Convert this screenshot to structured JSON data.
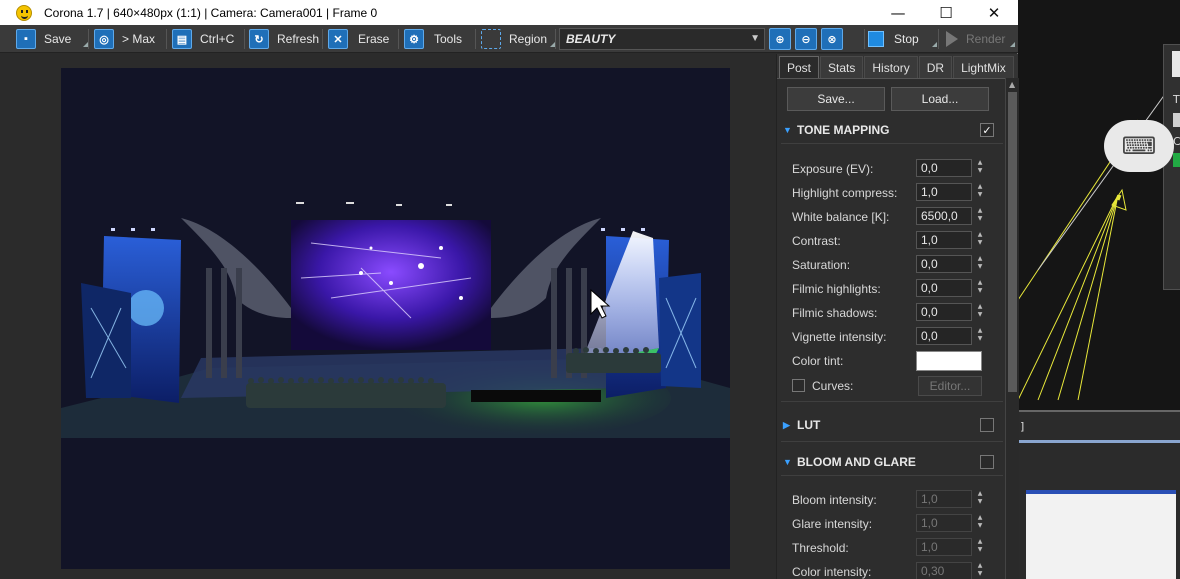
{
  "window": {
    "title": "Corona 1.7 | 640×480px (1:1) | Camera: Camera001 | Frame 0",
    "minimize": "—",
    "maximize": "☐",
    "close": "✕"
  },
  "toolbar": {
    "save": "Save",
    "max": "> Max",
    "copy": "Ctrl+C",
    "refresh": "Refresh",
    "erase": "Erase",
    "tools": "Tools",
    "region": "Region",
    "channel": "BEAUTY",
    "stop": "Stop",
    "render": "Render"
  },
  "tabs": [
    "Post",
    "Stats",
    "History",
    "DR",
    "LightMix"
  ],
  "post": {
    "save_btn": "Save...",
    "load_btn": "Load...",
    "tone_mapping": {
      "title": "TONE MAPPING",
      "enabled": "✓",
      "props": [
        {
          "label": "Exposure (EV):",
          "value": "0,0"
        },
        {
          "label": "Highlight compress:",
          "value": "1,0"
        },
        {
          "label": "White balance [K]:",
          "value": "6500,0"
        },
        {
          "label": "Contrast:",
          "value": "1,0"
        },
        {
          "label": "Saturation:",
          "value": "0,0"
        },
        {
          "label": "Filmic highlights:",
          "value": "0,0"
        },
        {
          "label": "Filmic shadows:",
          "value": "0,0"
        },
        {
          "label": "Vignette intensity:",
          "value": "0,0"
        }
      ],
      "color_tint_label": "Color tint:",
      "color_tint": "#ffffff",
      "curves_label": "Curves:",
      "editor_btn": "Editor..."
    },
    "lut": {
      "title": "LUT"
    },
    "bloom": {
      "title": "BLOOM AND GLARE",
      "props": [
        {
          "label": "Bloom intensity:",
          "value": "1,0"
        },
        {
          "label": "Glare intensity:",
          "value": "1,0"
        },
        {
          "label": "Threshold:",
          "value": "1,0"
        },
        {
          "label": "Color intensity:",
          "value": "0,30"
        }
      ]
    }
  },
  "colors": {
    "accent": "#1f6fb8",
    "panel_bg": "#2d2d2d",
    "toolbar_bg": "#3a3a3a"
  }
}
